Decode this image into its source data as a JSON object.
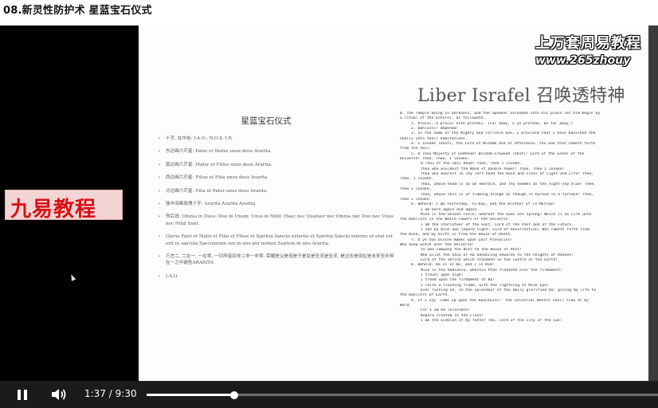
{
  "window": {
    "title": "08.新灵性防护术 星蓝宝石仪式"
  },
  "slide": {
    "left": {
      "title": "星蓝宝石仪式",
      "items": [
        "十字, 在中央: I.A.O.; N.O.X. I.R.",
        "东边画六芒星: Pater et Mater unus deus Ararita.",
        "南边画六芒星: Mater et Filius unus deus Ararita.",
        "西边画六芒星: Filius et Filia unus deus Ararita.",
        "北边画六芒星: Filia et Pater unus deus Ararita.",
        "独中间画玫瑰十字: Ararita Ararita Ararita",
        "然后说: Omnia in Duos: Duo in Unum: Unus in Nihil: Haec nec Quatuor nec Omnia nec Duo nec Unus nec Nihil Sunt.",
        "Gloria Patri et Matri et Filio et Filiae et Spiritui Sancto externo et Spiritui Sancto interno ut erat est erit in saecula Saeculorum sex in uno per nomen Septem in uno Ararita.",
        "万言二, 二在一, 一在零, 一切所皆四非二非一非零. 荣耀是父是母是子是女是圣灵是圣灵, 是过去是现在是未来至永恒在一之中遍性ARARITA.",
        "I.A.O."
      ]
    },
    "right": {
      "title": "Liber Israfel 召唤透特神",
      "lines": [
        {
          "t": "0. The Temple being in darkness, and the Speaker ascended into his place let him begin by",
          "c": ""
        },
        {
          "t": "a ritual of the Enterer, as followeth.",
          "c": ""
        },
        {
          "t": "1. Procul, O procul este profani. (Far away, o ye profane, be far away.)",
          "c": "i1"
        },
        {
          "t": "2. Bahlasti! Ompehda!",
          "c": "i1"
        },
        {
          "t": "3. In the name of the Mighty and Terrible One, I proclaim that I have banished the",
          "c": "i1"
        },
        {
          "t": "Shells unto their habitations.",
          "c": ""
        },
        {
          "t": "4. I invoke Tahuti, the Lord of Wisdom and of Utterance, the God that cometh forth",
          "c": "i1"
        },
        {
          "t": "from the Veil.",
          "c": ""
        },
        {
          "t": "5. O Thou Majesty of Godhead! Wisdom-crowned Tahuti! Lord of the Gates of the",
          "c": "i1"
        },
        {
          "t": "Universe! Thee, Thee, I invoke.",
          "c": ""
        },
        {
          "t": "O Thou of the Ibis Head! Thee, Thee I invoke.",
          "c": "i2"
        },
        {
          "t": "Thou who wieldest the Wand of Double Power! Thee, Thee I invoke!",
          "c": "i2"
        },
        {
          "t": "Thou who bearest in Thy left hand the Rose and Cross of Light and Life! Thee,",
          "c": "i2"
        },
        {
          "t": "Thee, I invoke.",
          "c": ""
        },
        {
          "t": "Thou, whose head is as an emerald, and Thy nemmes as the night-sky blue! Thee,",
          "c": "i2"
        },
        {
          "t": "Thee I invoke.",
          "c": ""
        },
        {
          "t": "Thou, whose skin is of flaming orange as though it burned in a furnace! Thee,",
          "c": "i2"
        },
        {
          "t": "Thee I invoke.",
          "c": ""
        },
        {
          "t": "6. Behold! I am Yesterday, To-Day, and the Brother of To-Morrow!",
          "c": "i1"
        },
        {
          "t": "I am born again and again.",
          "c": "i2"
        },
        {
          "t": "Mine is the Unseen Force, whereof the Gods are sprung! Which is as Life unto",
          "c": "i2"
        },
        {
          "t": "the Dwellers in the Watch-Towers of the Universe.",
          "c": ""
        },
        {
          "t": "I am the Charioteer of the East, Lord of the Past and of the Future.",
          "c": "i2"
        },
        {
          "t": "I see by mine own inward light: Lord of Resurrection; Who cometh forth from",
          "c": "i2"
        },
        {
          "t": "the Dusk, and my birth is from the House of Death.",
          "c": ""
        },
        {
          "t": "7. O ye two Divine Hawks upon your Pinnacles!",
          "c": "i1"
        },
        {
          "t": "Who keep watch over the Universe!",
          "c": ""
        },
        {
          "t": "Ye who company the Bier to the House of Rest!",
          "c": "i2"
        },
        {
          "t": "Who pilot the Ship of Ra advancing onwards to the heights of Heaven!",
          "c": "i2"
        },
        {
          "t": "Lord of the Shrine which standeth in the Centre of the Earth!",
          "c": "i2"
        },
        {
          "t": "8. Behold, He is in me, and I in Him!",
          "c": "i1"
        },
        {
          "t": "Mine is the Radiance, wherein Ptah floateth over the firmament!",
          "c": "i2"
        },
        {
          "t": "I travel upon high!",
          "c": "i2"
        },
        {
          "t": "I tread upon the firmament of Nu!",
          "c": "i2"
        },
        {
          "t": "I raise a flashing flame, with the lightning of Mine Eye!",
          "c": "i2"
        },
        {
          "t": "Ever rushing on, in the splendour of the daily glorified Ra: giving my life to",
          "c": "i2"
        },
        {
          "t": "the Dwellers of Earth.",
          "c": ""
        },
        {
          "t": "9. If I say 'Come up upon the mountains!' the Celestial Waters shall flow at my",
          "c": "i1"
        },
        {
          "t": "Word.",
          "c": ""
        },
        {
          "t": "For I am Ra incarnate!",
          "c": "i2"
        },
        {
          "t": "Kephra created in the Flesh!",
          "c": "i2"
        },
        {
          "t": "I am the Eidolon of my father Tmu, Lord of the City of the Sun!",
          "c": "i2"
        }
      ]
    }
  },
  "watermarks": {
    "site_cn": "上万套周易教程",
    "site_url": "www.265zhouy",
    "logo": "九易教程"
  },
  "player": {
    "time_current": "1:37",
    "time_separator": "/",
    "time_total": "9:30",
    "progress": 0.172,
    "icons": {
      "play_pause": "pause-icon",
      "volume": "volume-icon"
    }
  }
}
